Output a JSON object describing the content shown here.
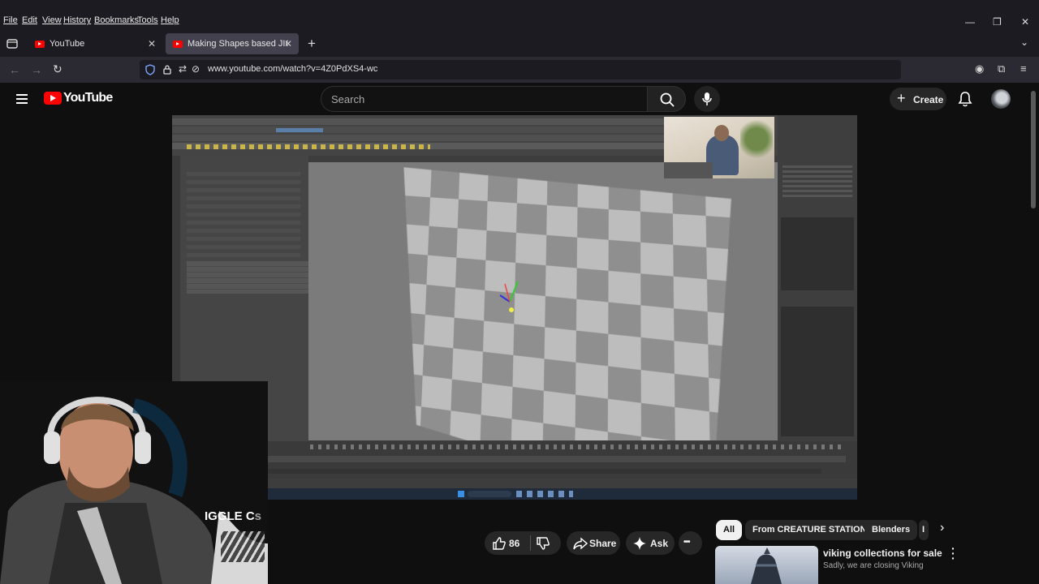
{
  "browser": {
    "menu": [
      "File",
      "Edit",
      "View",
      "History",
      "Bookmarks",
      "Tools",
      "Help"
    ],
    "tabs": [
      {
        "title": "YouTube",
        "active": false
      },
      {
        "title": "Making Shapes based JIGGLE C",
        "active": true
      }
    ],
    "new_tab_symbol": "+",
    "url": "www.youtube.com/watch?v=4Z0PdXS4-wc"
  },
  "youtube": {
    "logo_text": "YouTube",
    "search_placeholder": "Search",
    "create_label": "Create"
  },
  "video": {
    "title_partial": "IGGLE C",
    "title_partial_suffix": "s"
  },
  "actions": {
    "like_count": "86",
    "share_label": "Share",
    "ask_label": "Ask",
    "more_symbol": "•••"
  },
  "chips": [
    "All",
    "From CREATURE STATION",
    "Blenders",
    "I"
  ],
  "recommendation": {
    "title": "viking collections for sale",
    "description": "Sadly, we are closing Viking"
  },
  "colors": {
    "brand_red": "#ff0000",
    "background": "#0f0f0f",
    "chip_bg": "#272727"
  }
}
